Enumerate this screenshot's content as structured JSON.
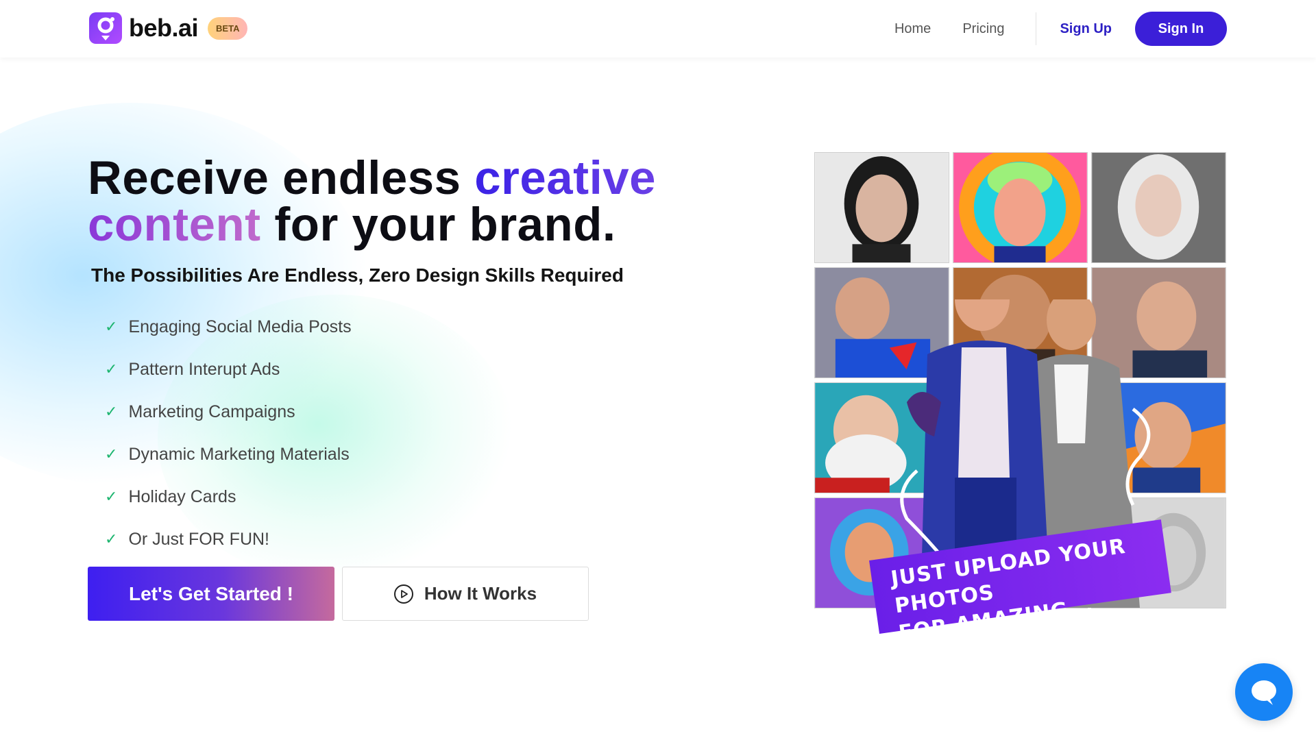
{
  "brand": {
    "name": "beb.ai",
    "badge": "BETA",
    "logo_icon": "camera-pin-icon",
    "accent": "#3b1fd8"
  },
  "nav": {
    "home": "Home",
    "pricing": "Pricing",
    "sign_up": "Sign Up",
    "sign_in": "Sign In"
  },
  "hero": {
    "title_part1": "Receive endless ",
    "title_highlight1": "creative",
    "title_highlight2": "content",
    "title_part2": " for your brand.",
    "subtitle": "The Possibilities Are Endless, Zero Design Skills Required",
    "check_glyph": "✓",
    "features": [
      "Engaging Social Media Posts",
      "Pattern Interupt Ads",
      "Marketing Campaigns",
      "Dynamic Marketing Materials",
      "Holiday Cards",
      "Or Just FOR FUN!"
    ],
    "cta_primary": "Let's Get Started !",
    "cta_secondary": "How It Works"
  },
  "collage": {
    "banner_line1": "JUST UPLOAD YOUR PHOTOS",
    "banner_line2": "FOR AMAZING RESULTS"
  },
  "chat": {
    "icon": "chat-icon",
    "color": "#1784f5"
  }
}
